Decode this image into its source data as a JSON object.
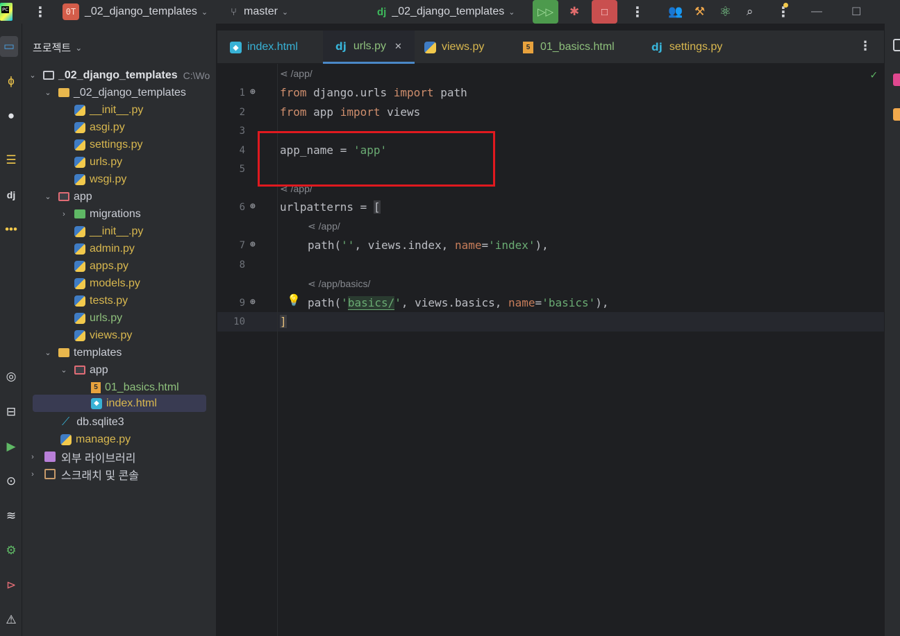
{
  "titlebar": {
    "project_badge": "0T",
    "project_name": "_02_django_templates",
    "branch": "master",
    "run_config": "_02_django_templates"
  },
  "project_panel": {
    "title": "프로젝트",
    "root": {
      "name": "_02_django_templates",
      "path": "C:\\Wo"
    },
    "items": [
      {
        "name": "_02_django_templates"
      },
      {
        "name": "__init__.py"
      },
      {
        "name": "asgi.py"
      },
      {
        "name": "settings.py"
      },
      {
        "name": "urls.py"
      },
      {
        "name": "wsgi.py"
      },
      {
        "name": "app"
      },
      {
        "name": "migrations"
      },
      {
        "name": "__init__.py"
      },
      {
        "name": "admin.py"
      },
      {
        "name": "apps.py"
      },
      {
        "name": "models.py"
      },
      {
        "name": "tests.py"
      },
      {
        "name": "urls.py"
      },
      {
        "name": "views.py"
      },
      {
        "name": "templates"
      },
      {
        "name": "app"
      },
      {
        "name": "01_basics.html"
      },
      {
        "name": "index.html"
      },
      {
        "name": "db.sqlite3"
      },
      {
        "name": "manage.py"
      },
      {
        "name": "외부 라이브러리"
      },
      {
        "name": "스크래치 및 콘솔"
      }
    ]
  },
  "tabs": [
    {
      "label": "index.html",
      "active": false
    },
    {
      "label": "urls.py",
      "active": true
    },
    {
      "label": "views.py",
      "active": false
    },
    {
      "label": "01_basics.html",
      "active": false
    },
    {
      "label": "settings.py",
      "active": false
    }
  ],
  "editor": {
    "hints": [
      "/app/",
      "/app/",
      "/app/",
      "/app/basics/"
    ],
    "line_numbers": [
      "1",
      "2",
      "3",
      "4",
      "5",
      "6",
      "7",
      "8",
      "9",
      "10"
    ],
    "code": {
      "l1": {
        "kw1": "from",
        "t1": " django.urls ",
        "kw2": "import",
        "t2": " path"
      },
      "l2": {
        "kw1": "from",
        "t1": " app ",
        "kw2": "import",
        "t2": " views"
      },
      "l4": {
        "t1": "app_name = ",
        "s1": "'app'"
      },
      "l6": {
        "t1": "urlpatterns = ",
        "b": "["
      },
      "l7": {
        "f": "path(",
        "s1": "''",
        "t1": ", views.index, ",
        "p": "name",
        "eq": "=",
        "s2": "'index'",
        "end": "),"
      },
      "l9": {
        "f": "path(",
        "q1": "'",
        "s1": "basics/",
        "q2": "'",
        "t1": ", views.basics, ",
        "p": "name",
        "eq": "=",
        "s2": "'basics'",
        "end": "),"
      },
      "l10": {
        "b": "]"
      }
    }
  },
  "colors": {
    "keyword": "#cf8e6d",
    "string": "#6aab73",
    "param": "#c77d5a",
    "highlight_box": "#e0191f",
    "run_button": "#4d9a4d",
    "stop_button": "#c94f4f"
  },
  "icons": {
    "run": "run-icon",
    "debug": "bug-icon",
    "stop": "stop-icon",
    "search": "search-icon"
  }
}
